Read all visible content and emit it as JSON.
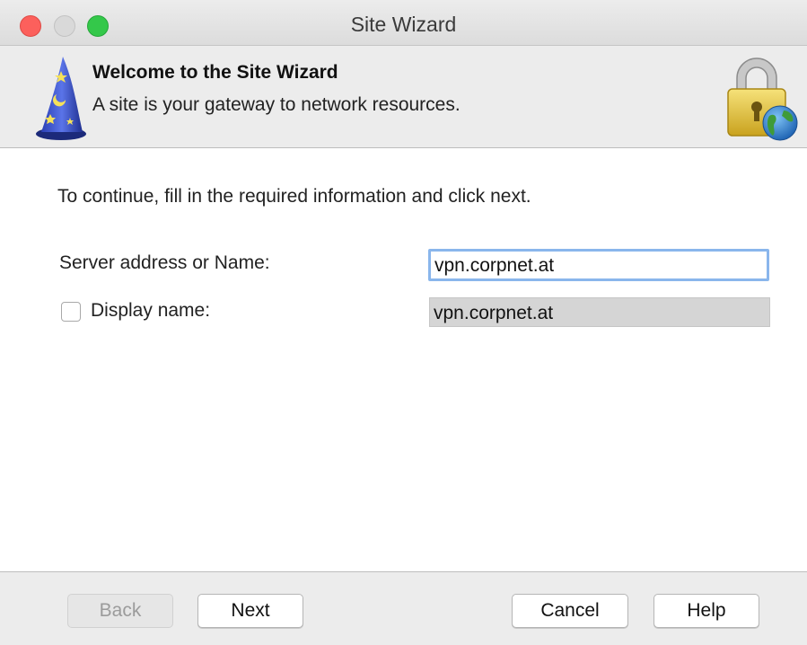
{
  "window": {
    "title": "Site Wizard"
  },
  "banner": {
    "title": "Welcome to the Site Wizard",
    "subtitle": "A site is your gateway to network resources.",
    "left_icon": "wizard-hat-icon",
    "right_icon": "lock-globe-icon"
  },
  "form": {
    "instructions": "To continue, fill in the required information and click next.",
    "server_label": "Server address or Name:",
    "server_value": "vpn.corpnet.at",
    "display_label": "Display name:",
    "display_checked": false,
    "display_value": "vpn.corpnet.at"
  },
  "buttons": {
    "back": "Back",
    "next": "Next",
    "cancel": "Cancel",
    "help": "Help"
  },
  "colors": {
    "close_light": "#fc605c",
    "max_light": "#34c84a",
    "focus_ring": "#8ab6ec"
  }
}
